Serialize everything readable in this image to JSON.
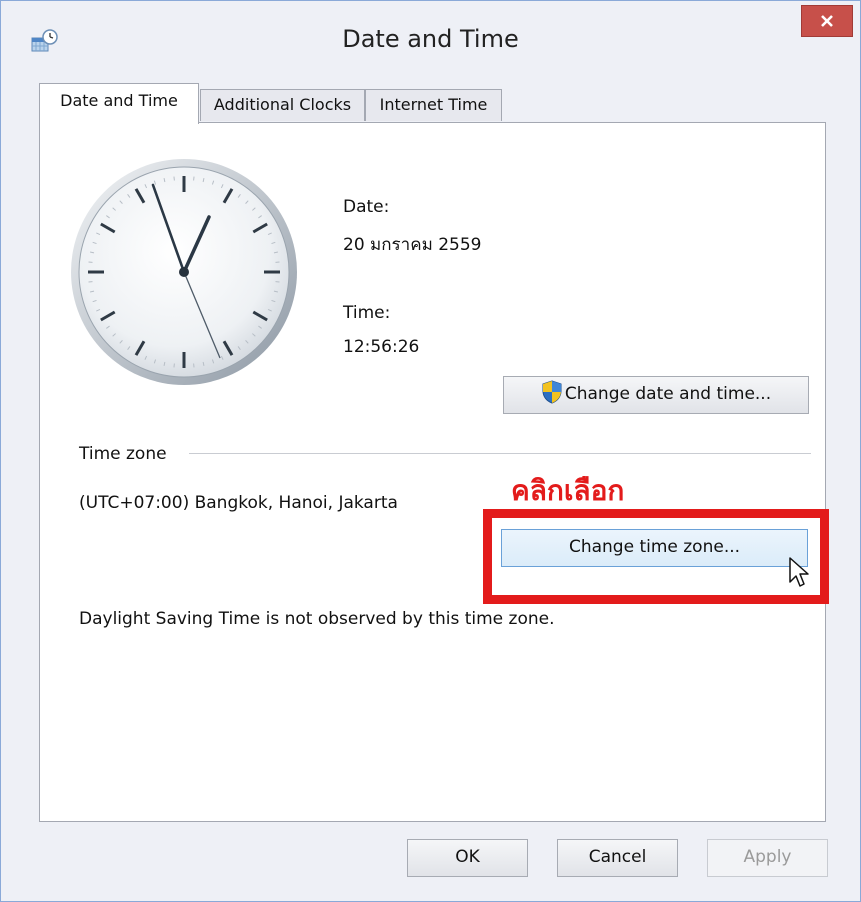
{
  "window": {
    "title": "Date and Time",
    "icon": "date-time-control-panel-icon",
    "close_icon": "close-icon"
  },
  "tabs": [
    {
      "label": "Date and Time",
      "active": true
    },
    {
      "label": "Additional Clocks",
      "active": false
    },
    {
      "label": "Internet Time",
      "active": false
    }
  ],
  "date": {
    "label": "Date:",
    "value": "20 มกราคม 2559"
  },
  "time": {
    "label": "Time:",
    "value": "12:56:26"
  },
  "change_datetime_button": {
    "label": "Change date and time...",
    "icon": "uac-shield-icon"
  },
  "time_zone": {
    "section_label": "Time zone",
    "value": "(UTC+07:00) Bangkok, Hanoi, Jakarta",
    "change_button": "Change time zone...",
    "dst_note": "Daylight Saving Time is not observed by this time zone."
  },
  "annotation": {
    "text": "คลิกเลือก",
    "color": "#e31b1b"
  },
  "footer": {
    "ok": "OK",
    "cancel": "Cancel",
    "apply": "Apply"
  },
  "colors": {
    "window_bg": "#eef0f6",
    "close_button": "#c7504a",
    "focus_blue": "#6aa1d8"
  }
}
